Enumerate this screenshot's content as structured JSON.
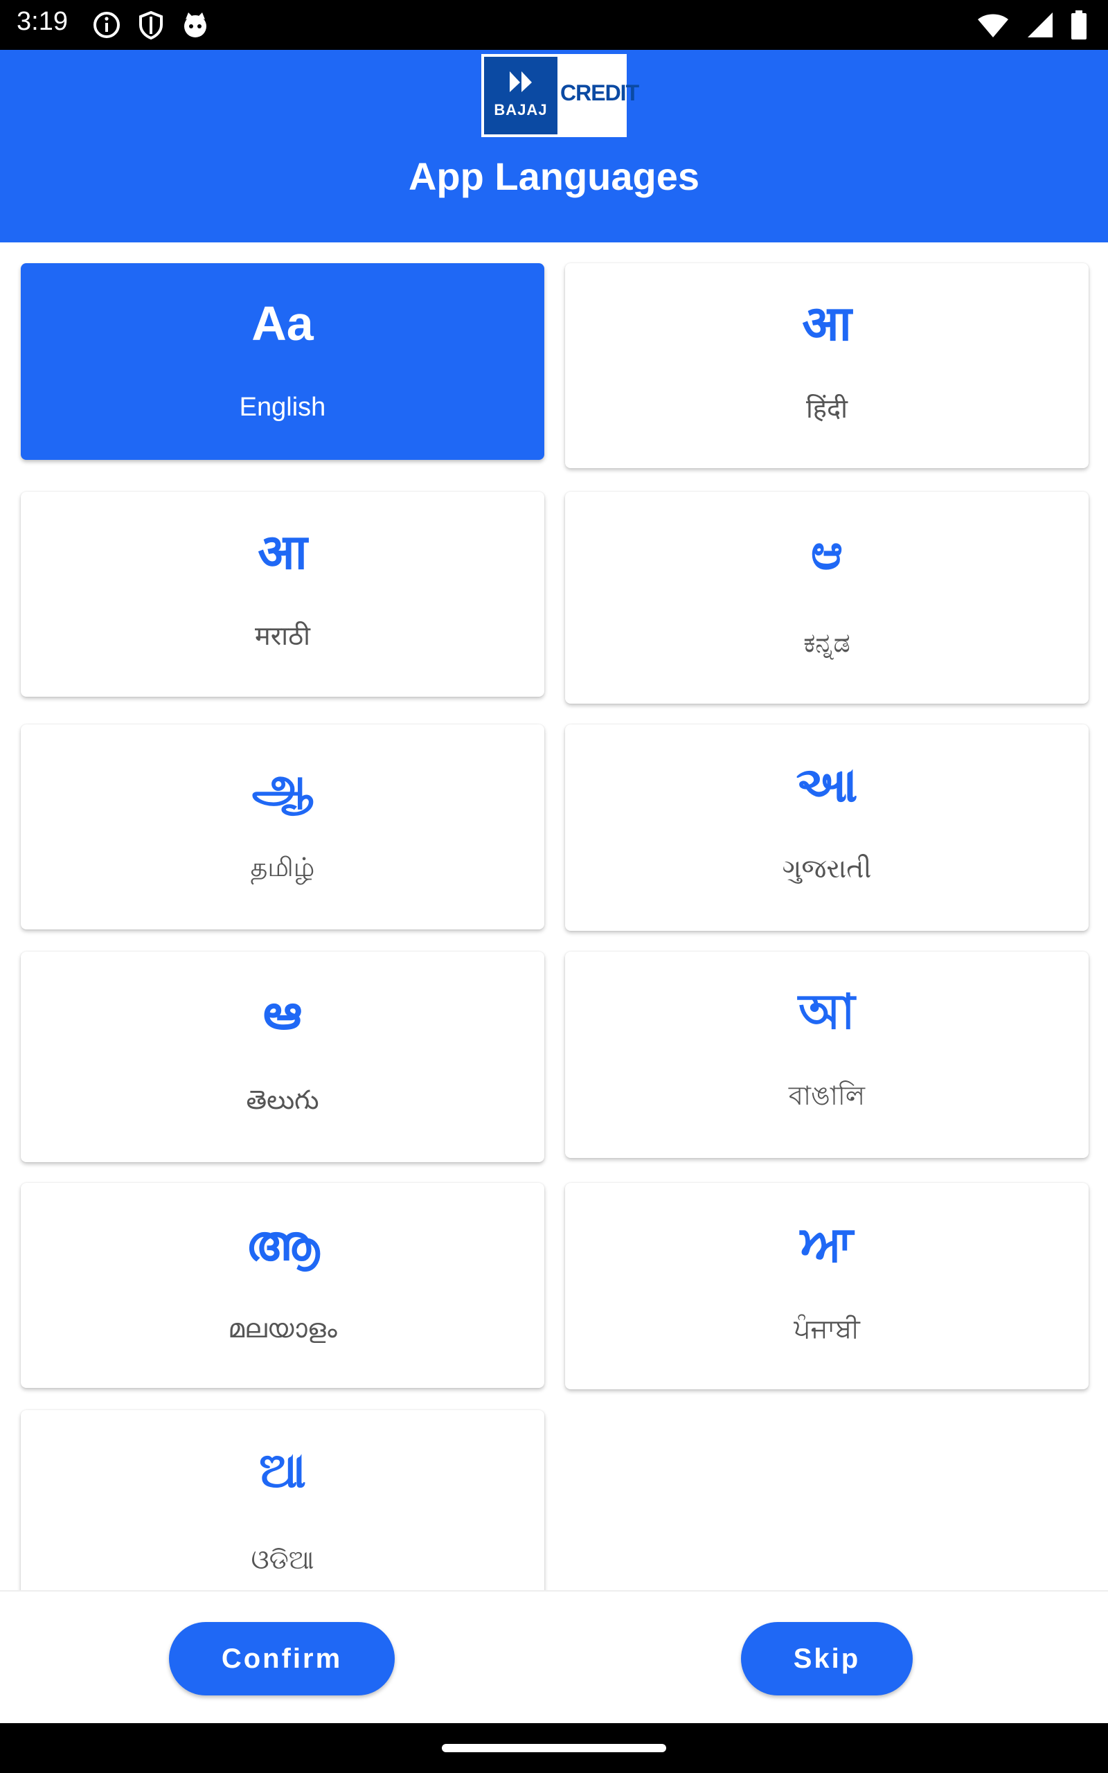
{
  "status_bar": {
    "time": "3:19"
  },
  "header": {
    "logo_brand": "BAJAJ",
    "logo_text": "CREDIT",
    "title": "App Languages"
  },
  "languages": [
    {
      "glyph": "Aa",
      "name": "English",
      "selected": true
    },
    {
      "glyph": "आ",
      "name": "हिंदी",
      "selected": false
    },
    {
      "glyph": "आ",
      "name": "मराठी",
      "selected": false
    },
    {
      "glyph": "ಆ",
      "name": "ಕನ್ನಡ",
      "selected": false
    },
    {
      "glyph": "ஆ",
      "name": "தமிழ்",
      "selected": false
    },
    {
      "glyph": "આ",
      "name": "ગુજરાતી",
      "selected": false
    },
    {
      "glyph": "ఆ",
      "name": "తెలుగు",
      "selected": false
    },
    {
      "glyph": "আ",
      "name": "বাঙালি",
      "selected": false
    },
    {
      "glyph": "ആ",
      "name": "മലയാളം",
      "selected": false
    },
    {
      "glyph": "ਆ",
      "name": "ਪੰਜਾਬੀ",
      "selected": false
    },
    {
      "glyph": "ଆ",
      "name": "ଓଡିଆ",
      "selected": false
    }
  ],
  "actions": {
    "confirm": "Confirm",
    "skip": "Skip"
  },
  "colors": {
    "primary": "#1f68f5",
    "logo_blue": "#0b4aa3"
  },
  "icons": [
    "info-icon",
    "shield-icon",
    "cat-icon",
    "wifi-icon",
    "signal-icon",
    "battery-icon"
  ]
}
